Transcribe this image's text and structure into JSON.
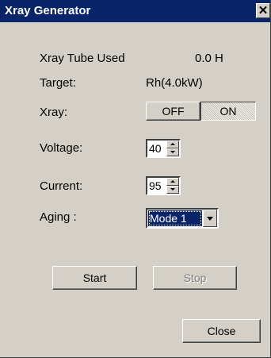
{
  "window": {
    "title": "Xray Generator",
    "close_glyph": "✕"
  },
  "fields": {
    "tube_label": "Xray Tube Used",
    "tube_value": "0.0 H",
    "target_label": "Target:",
    "target_value": "Rh(4.0kW)",
    "xray_label": "Xray:",
    "xray_off": "OFF",
    "xray_on": "ON",
    "xray_state": "ON",
    "voltage_label": "Voltage:",
    "voltage_value": "40",
    "current_label": "Current:",
    "current_value": "95",
    "aging_label": "Aging :",
    "aging_value": "Mode 1"
  },
  "buttons": {
    "start": "Start",
    "stop": "Stop",
    "close": "Close"
  },
  "colors": {
    "titlebar": "#0a246a",
    "face": "#d4d0c8",
    "disabled_text": "#808080"
  }
}
